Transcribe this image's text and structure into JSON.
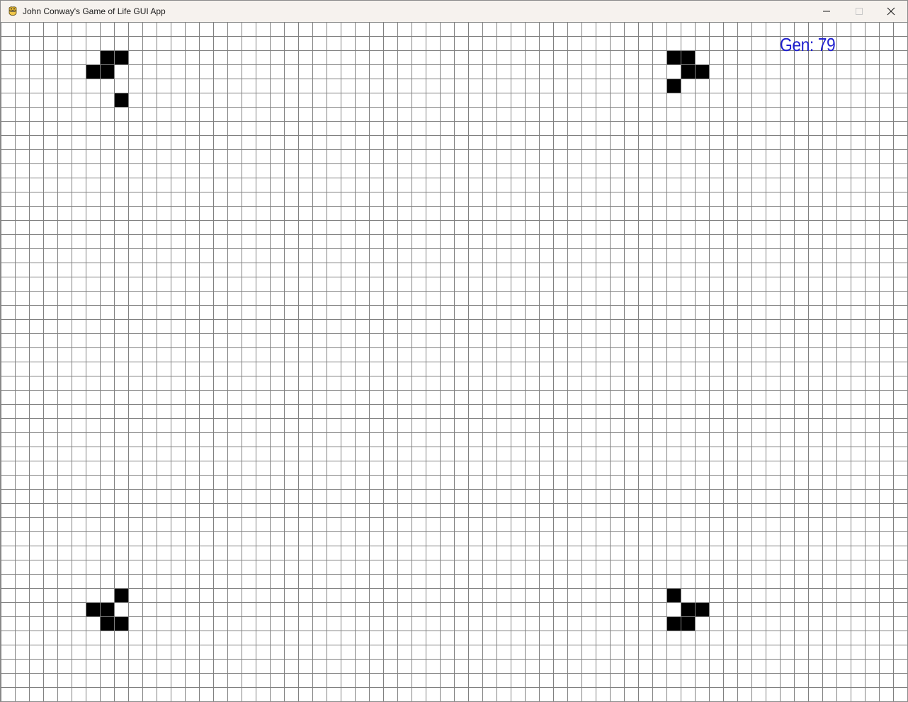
{
  "window": {
    "title": "John Conway's Game of Life GUI App",
    "icon": "python-snake-icon",
    "controls": [
      "minimize",
      "maximize",
      "close"
    ]
  },
  "board": {
    "columns": 64,
    "rows": 48,
    "live_cells": [
      [
        7,
        2
      ],
      [
        8,
        2
      ],
      [
        6,
        3
      ],
      [
        7,
        3
      ],
      [
        8,
        5
      ],
      [
        47,
        2
      ],
      [
        48,
        2
      ],
      [
        48,
        3
      ],
      [
        49,
        3
      ],
      [
        47,
        4
      ],
      [
        8,
        40
      ],
      [
        6,
        41
      ],
      [
        7,
        41
      ],
      [
        7,
        42
      ],
      [
        8,
        42
      ],
      [
        47,
        40
      ],
      [
        48,
        41
      ],
      [
        49,
        41
      ],
      [
        47,
        42
      ],
      [
        48,
        42
      ]
    ],
    "colors": {
      "background": "#ffffff",
      "grid_line": "#808080",
      "live_cell": "#000000"
    }
  },
  "generation": {
    "label": "Gen:",
    "value": "79",
    "color": "#1f1fcf"
  }
}
